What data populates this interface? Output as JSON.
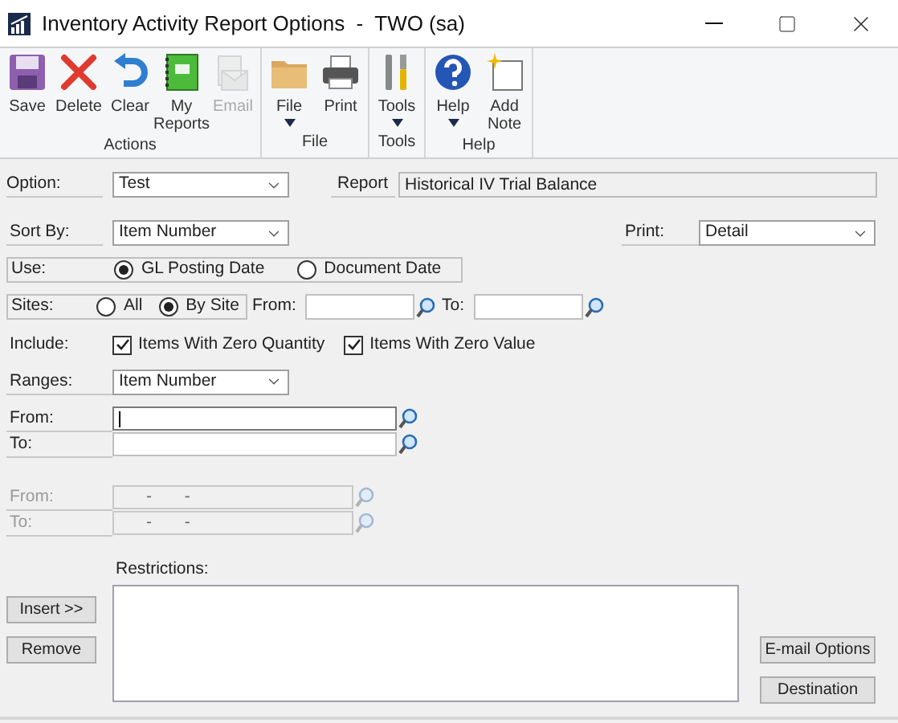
{
  "window": {
    "title": "Inventory Activity Report Options  -  TWO (sa)"
  },
  "ribbon": {
    "groups": [
      {
        "label": "Actions",
        "buttons": [
          {
            "label": "Save",
            "kind": "save",
            "disabled": false,
            "dropdown": false
          },
          {
            "label": "Delete",
            "kind": "delete",
            "disabled": false,
            "dropdown": false
          },
          {
            "label": "Clear",
            "kind": "clear",
            "disabled": false,
            "dropdown": false
          },
          {
            "label": "My Reports",
            "kind": "reports",
            "disabled": false,
            "dropdown": false
          },
          {
            "label": "Email",
            "kind": "email",
            "disabled": true,
            "dropdown": false
          }
        ]
      },
      {
        "label": "File",
        "buttons": [
          {
            "label": "File",
            "kind": "folder",
            "disabled": false,
            "dropdown": true
          },
          {
            "label": "Print",
            "kind": "print",
            "disabled": false,
            "dropdown": false
          }
        ]
      },
      {
        "label": "Tools",
        "buttons": [
          {
            "label": "Tools",
            "kind": "tools",
            "disabled": false,
            "dropdown": true
          }
        ]
      },
      {
        "label": "Help",
        "buttons": [
          {
            "label": "Help",
            "kind": "help",
            "disabled": false,
            "dropdown": true
          },
          {
            "label": "Add Note",
            "kind": "note",
            "disabled": false,
            "dropdown": false
          }
        ]
      }
    ]
  },
  "form": {
    "option": {
      "label": "Option:",
      "value": "Test"
    },
    "report": {
      "label": "Report",
      "value": "Historical IV Trial Balance"
    },
    "sort_by": {
      "label": "Sort By:",
      "value": "Item Number"
    },
    "print": {
      "label": "Print:",
      "value": "Detail"
    },
    "use": {
      "label": "Use:",
      "options": [
        {
          "label": "GL Posting Date",
          "selected": true
        },
        {
          "label": "Document Date",
          "selected": false
        }
      ]
    },
    "sites": {
      "label": "Sites:",
      "options": [
        {
          "label": "All",
          "selected": false
        },
        {
          "label": "By Site",
          "selected": true
        }
      ],
      "from_label": "From:",
      "to_label": "To:"
    },
    "include": {
      "label": "Include:",
      "options": [
        {
          "label": "Items With Zero Quantity",
          "checked": true
        },
        {
          "label": "Items With Zero Value",
          "checked": true
        }
      ]
    },
    "ranges": {
      "label": "Ranges:",
      "value": "Item Number"
    },
    "range_fields": [
      {
        "label": "From:",
        "focused": true
      },
      {
        "label": "To:",
        "focused": false
      }
    ],
    "disabled_range_fields": [
      {
        "label": "From:",
        "value": "-       -"
      },
      {
        "label": "To:",
        "value": "-       -"
      }
    ],
    "restrictions": {
      "label": "Restrictions:"
    },
    "left_buttons": [
      "Insert >>",
      "Remove"
    ],
    "right_buttons": [
      "E-mail Options",
      "Destination"
    ]
  }
}
